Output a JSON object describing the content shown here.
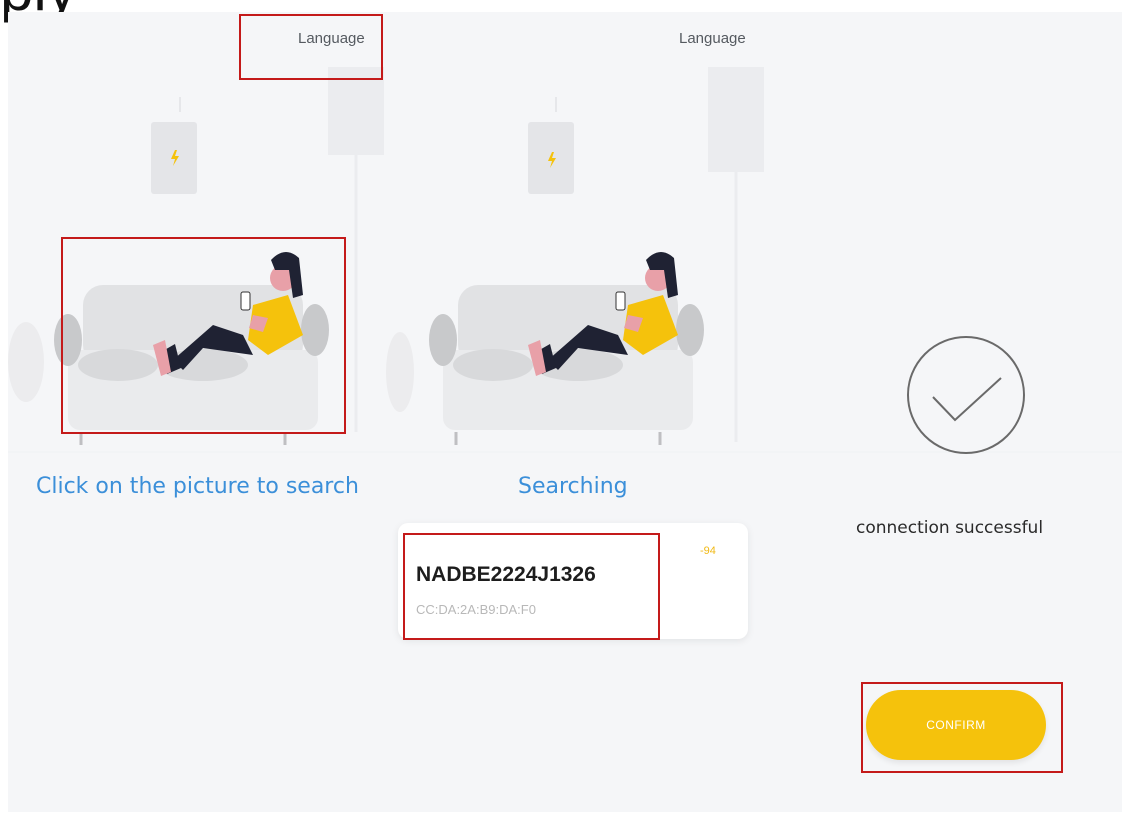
{
  "top_fragment": "ply",
  "header": {
    "language_left": "Language",
    "language_right": "Language"
  },
  "step1": {
    "instruction": "Click on the picture to search"
  },
  "step2": {
    "status": "Searching",
    "device": {
      "name": "NADBE2224J1326",
      "mac": "CC:DA:2A:B9:DA:F0",
      "signal": "-94"
    }
  },
  "step3": {
    "status": "connection successful",
    "confirm_label": "CONFIRM"
  },
  "colors": {
    "accent_yellow": "#f5c20c",
    "link_blue": "#3b8fd9",
    "annotation_red": "#c41a1a",
    "panel_bg": "#f5f6f8"
  }
}
